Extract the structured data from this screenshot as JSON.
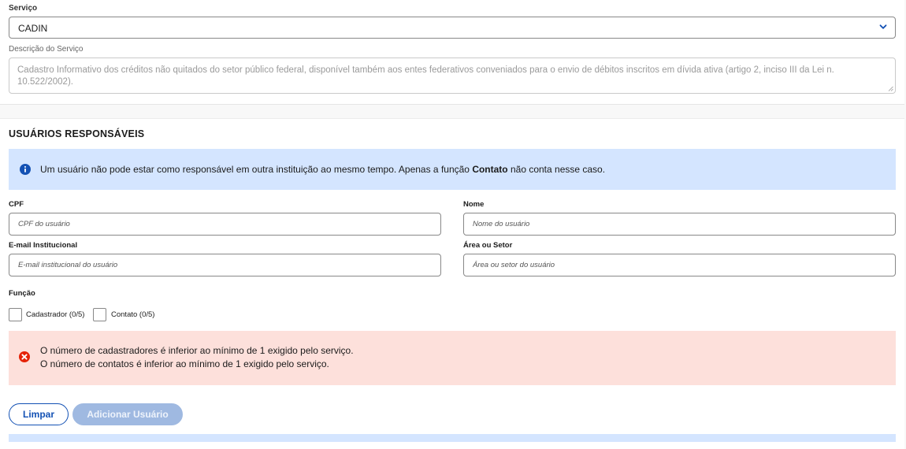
{
  "service": {
    "label": "Serviço",
    "selected": "CADIN",
    "description_label": "Descrição do Serviço",
    "description": "Cadastro Informativo dos créditos não quitados do setor público federal, disponível também aos entes federativos conveniados para o envio de débitos inscritos em dívida ativa (artigo 2, inciso III da Lei n. 10.522/2002)."
  },
  "users_section": {
    "title": "USUÁRIOS RESPONSÁVEIS",
    "info_text_before": "Um usuário não pode estar como responsável em outra instituição ao mesmo tempo. Apenas a função ",
    "info_text_bold": "Contato",
    "info_text_after": " não conta nesse caso."
  },
  "form": {
    "cpf_label": "CPF",
    "cpf_placeholder": "CPF do usuário",
    "name_label": "Nome",
    "name_placeholder": "Nome do usuário",
    "email_label": "E-mail Institucional",
    "email_placeholder": "E-mail institucional do usuário",
    "area_label": "Área ou Setor",
    "area_placeholder": "Área ou setor do usuário",
    "role_label": "Função",
    "roles": [
      {
        "label": "Cadastrador (0/5)",
        "checked": false
      },
      {
        "label": "Contato (0/5)",
        "checked": false
      }
    ]
  },
  "errors": [
    "O número de cadastradores é inferior ao mínimo de 1 exigido pelo serviço.",
    "O número de contatos é inferior ao mínimo de 1 exigido pelo serviço."
  ],
  "actions": {
    "clear_label": "Limpar",
    "add_label": "Adicionar Usuário"
  },
  "icons": {
    "select": "chevron-down-icon",
    "info": "info-icon",
    "error": "error-icon"
  },
  "colors": {
    "primary": "#1351b4",
    "info_bg": "#d4e5ff",
    "error_bg": "#fde0db",
    "error_icon": "#e52207",
    "disabled_button": "#9fb9e1"
  }
}
